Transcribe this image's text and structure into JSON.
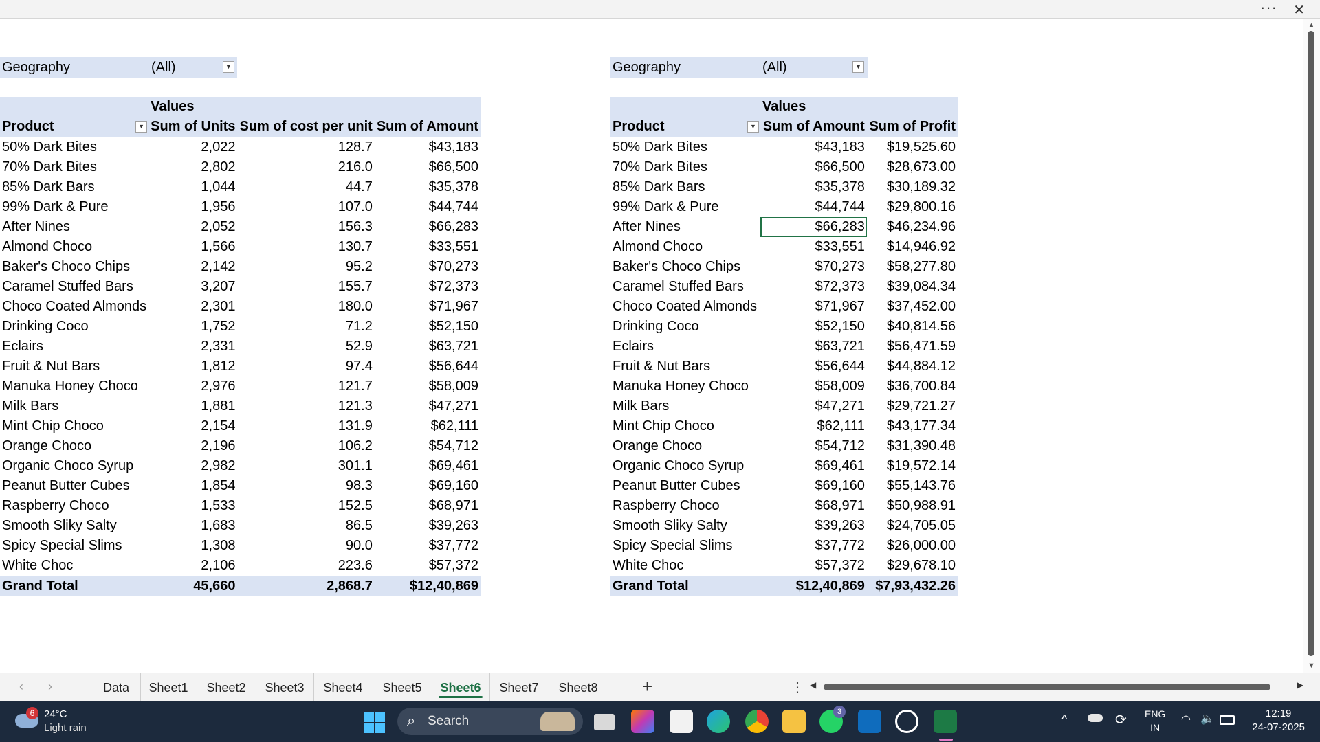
{
  "window": {
    "more_label": "···",
    "close_label": "✕"
  },
  "pivot_left": {
    "filter": {
      "label": "Geography",
      "value": "(All)"
    },
    "values_header": "Values",
    "columns": [
      "Product",
      "Sum of Units",
      "Sum of cost per unit",
      "Sum of Amount"
    ],
    "rows": [
      [
        "50% Dark Bites",
        "2,022",
        "128.7",
        "$43,183"
      ],
      [
        "70% Dark Bites",
        "2,802",
        "216.0",
        "$66,500"
      ],
      [
        "85% Dark Bars",
        "1,044",
        "44.7",
        "$35,378"
      ],
      [
        "99% Dark & Pure",
        "1,956",
        "107.0",
        "$44,744"
      ],
      [
        "After Nines",
        "2,052",
        "156.3",
        "$66,283"
      ],
      [
        "Almond Choco",
        "1,566",
        "130.7",
        "$33,551"
      ],
      [
        "Baker's Choco Chips",
        "2,142",
        "95.2",
        "$70,273"
      ],
      [
        "Caramel Stuffed Bars",
        "3,207",
        "155.7",
        "$72,373"
      ],
      [
        "Choco Coated Almonds",
        "2,301",
        "180.0",
        "$71,967"
      ],
      [
        "Drinking Coco",
        "1,752",
        "71.2",
        "$52,150"
      ],
      [
        "Eclairs",
        "2,331",
        "52.9",
        "$63,721"
      ],
      [
        "Fruit & Nut Bars",
        "1,812",
        "97.4",
        "$56,644"
      ],
      [
        "Manuka Honey Choco",
        "2,976",
        "121.7",
        "$58,009"
      ],
      [
        "Milk Bars",
        "1,881",
        "121.3",
        "$47,271"
      ],
      [
        "Mint Chip Choco",
        "2,154",
        "131.9",
        "$62,111"
      ],
      [
        "Orange Choco",
        "2,196",
        "106.2",
        "$54,712"
      ],
      [
        "Organic Choco Syrup",
        "2,982",
        "301.1",
        "$69,461"
      ],
      [
        "Peanut Butter Cubes",
        "1,854",
        "98.3",
        "$69,160"
      ],
      [
        "Raspberry Choco",
        "1,533",
        "152.5",
        "$68,971"
      ],
      [
        "Smooth Sliky Salty",
        "1,683",
        "86.5",
        "$39,263"
      ],
      [
        "Spicy Special Slims",
        "1,308",
        "90.0",
        "$37,772"
      ],
      [
        "White Choc",
        "2,106",
        "223.6",
        "$57,372"
      ]
    ],
    "total": [
      "Grand Total",
      "45,660",
      "2,868.7",
      "$12,40,869"
    ]
  },
  "pivot_right": {
    "filter": {
      "label": "Geography",
      "value": "(All)"
    },
    "values_header": "Values",
    "columns": [
      "Product",
      "Sum of Amount",
      "Sum of Profit"
    ],
    "rows": [
      [
        "50% Dark Bites",
        "$43,183",
        "$19,525.60"
      ],
      [
        "70% Dark Bites",
        "$66,500",
        "$28,673.00"
      ],
      [
        "85% Dark Bars",
        "$35,378",
        "$30,189.32"
      ],
      [
        "99% Dark & Pure",
        "$44,744",
        "$29,800.16"
      ],
      [
        "After Nines",
        "$66,283",
        "$46,234.96"
      ],
      [
        "Almond Choco",
        "$33,551",
        "$14,946.92"
      ],
      [
        "Baker's Choco Chips",
        "$70,273",
        "$58,277.80"
      ],
      [
        "Caramel Stuffed Bars",
        "$72,373",
        "$39,084.34"
      ],
      [
        "Choco Coated Almonds",
        "$71,967",
        "$37,452.00"
      ],
      [
        "Drinking Coco",
        "$52,150",
        "$40,814.56"
      ],
      [
        "Eclairs",
        "$63,721",
        "$56,471.59"
      ],
      [
        "Fruit & Nut Bars",
        "$56,644",
        "$44,884.12"
      ],
      [
        "Manuka Honey Choco",
        "$58,009",
        "$36,700.84"
      ],
      [
        "Milk Bars",
        "$47,271",
        "$29,721.27"
      ],
      [
        "Mint Chip Choco",
        "$62,111",
        "$43,177.34"
      ],
      [
        "Orange Choco",
        "$54,712",
        "$31,390.48"
      ],
      [
        "Organic Choco Syrup",
        "$69,461",
        "$19,572.14"
      ],
      [
        "Peanut Butter Cubes",
        "$69,160",
        "$55,143.76"
      ],
      [
        "Raspberry Choco",
        "$68,971",
        "$50,988.91"
      ],
      [
        "Smooth Sliky Salty",
        "$39,263",
        "$24,705.05"
      ],
      [
        "Spicy Special Slims",
        "$37,772",
        "$26,000.00"
      ],
      [
        "White Choc",
        "$57,372",
        "$29,678.10"
      ]
    ],
    "total": [
      "Grand Total",
      "$12,40,869",
      "$7,93,432.26"
    ]
  },
  "sheet_tabs": {
    "tabs": [
      "Data",
      "Sheet1",
      "Sheet2",
      "Sheet3",
      "Sheet4",
      "Sheet5",
      "Sheet6",
      "Sheet7",
      "Sheet8"
    ],
    "active": "Sheet6",
    "add_label": "+"
  },
  "taskbar": {
    "weather": {
      "badge": "6",
      "temp": "24°C",
      "condition": "Light rain"
    },
    "search_placeholder": "Search",
    "whatsapp_badge": "3",
    "language": {
      "line1": "ENG",
      "line2": "IN"
    },
    "clock": {
      "time": "12:19",
      "date": "24-07-2025"
    }
  }
}
